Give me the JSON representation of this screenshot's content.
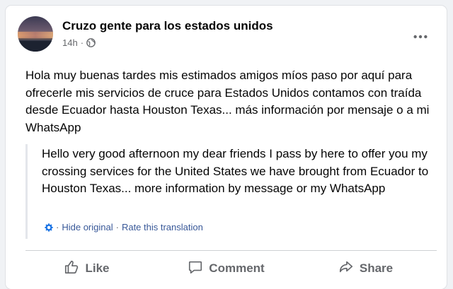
{
  "post": {
    "author": "Cruzo gente para los estados unidos",
    "time": "14h",
    "meta_separator": "·",
    "privacy_icon": "globe-icon",
    "more_icon": "more-options-icon",
    "text": "Hola muy buenas tardes mis estimados amigos míos paso por aquí para ofrecerle mis servicios de cruce para Estados Unidos contamos con traída desde Ecuador hasta Houston Texas... más información por mensaje o a mi WhatsApp"
  },
  "translation": {
    "text": "Hello very good afternoon my dear friends I pass by here to offer you my crossing services for the United States we have brought from Ecuador to Houston Texas... more information by message or my WhatsApp",
    "hide_label": "Hide original",
    "rate_label": "Rate this translation",
    "separator": "·",
    "icon": "gear-icon"
  },
  "actions": {
    "like_label": "Like",
    "comment_label": "Comment",
    "share_label": "Share"
  },
  "colors": {
    "link": "#385898",
    "muted": "#65676b",
    "text": "#050505"
  }
}
